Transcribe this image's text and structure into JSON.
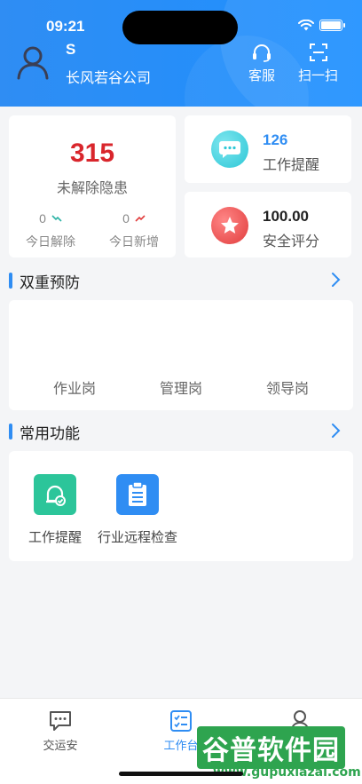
{
  "status_bar": {
    "time": "09:21"
  },
  "header": {
    "user_name": "S",
    "company": "长风若谷公司",
    "service_label": "客服",
    "scan_label": "扫一扫"
  },
  "hazard": {
    "count": "315",
    "label": "未解除隐患",
    "today_resolved_value": "0",
    "today_resolved_label": "今日解除",
    "today_new_value": "0",
    "today_new_label": "今日新增"
  },
  "work_reminder": {
    "value": "126",
    "label": "工作提醒"
  },
  "safety_score": {
    "value": "100.00",
    "label": "安全评分"
  },
  "dual_prevention": {
    "title": "双重预防",
    "tabs": [
      "作业岗",
      "管理岗",
      "领导岗"
    ]
  },
  "common_functions": {
    "title": "常用功能",
    "items": [
      {
        "label": "工作提醒",
        "icon": "bell-check-icon"
      },
      {
        "label": "行业远程检查",
        "icon": "clipboard-icon"
      }
    ]
  },
  "tabbar": {
    "items": [
      {
        "label": "交运安",
        "icon": "chat-icon"
      },
      {
        "label": "工作台",
        "icon": "checklist-icon"
      },
      {
        "label": "",
        "icon": "user-icon"
      }
    ]
  },
  "watermark": {
    "main": "谷普软件园",
    "sub": "www.gupuxiazai.com"
  },
  "colors": {
    "primary": "#2f8df3",
    "danger": "#d9262c",
    "teal": "#2cc7d6",
    "green": "#2cc59a"
  }
}
